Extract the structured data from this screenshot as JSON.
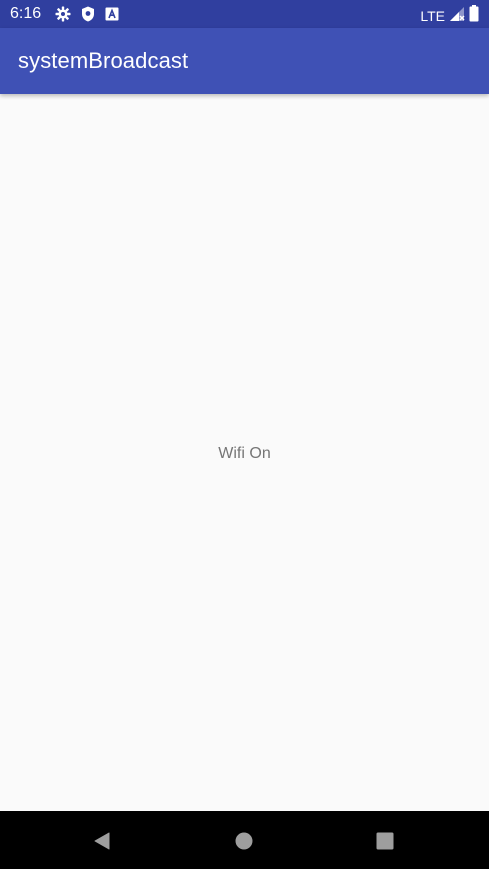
{
  "status_bar": {
    "time": "6:16",
    "network": "LTE",
    "icons": [
      "settings-icon",
      "shield-icon",
      "accessibility-icon",
      "signal-icon",
      "battery-icon"
    ],
    "background": "#303f9f"
  },
  "app_bar": {
    "title": "systemBroadcast",
    "background": "#3f51b5"
  },
  "main": {
    "status_text": "Wifi On",
    "text_color": "#757575",
    "background": "#fafafa"
  },
  "nav_bar": {
    "buttons": [
      "back-icon",
      "home-icon",
      "recents-icon"
    ],
    "background": "#000000"
  }
}
